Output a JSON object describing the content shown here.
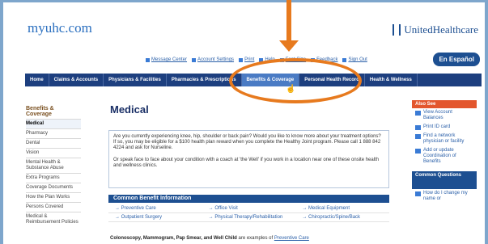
{
  "header": {
    "logo": "myuhc.com",
    "brand": "UnitedHealthcare",
    "espanol": "En Español"
  },
  "util_links": [
    "Message Center",
    "Account Settings",
    "Print",
    "Help",
    "Font Size",
    "Feedback",
    "Sign Out"
  ],
  "nav": [
    {
      "label": "Home"
    },
    {
      "label": "Claims & Accounts"
    },
    {
      "label": "Physicians & Facilities"
    },
    {
      "label": "Pharmacies & Prescriptions"
    },
    {
      "label": "Benefits & Coverage"
    },
    {
      "label": "Personal Health Record"
    },
    {
      "label": "Health & Wellness"
    }
  ],
  "sidebar": {
    "heading": "Benefits & Coverage",
    "items": [
      "Medical",
      "Pharmacy",
      "Dental",
      "Vision",
      "Mental Health & Substance Abuse",
      "Extra Programs",
      "Coverage Documents",
      "How the Plan Works",
      "Persons Covered",
      "Medical & Reimbursement Policies"
    ]
  },
  "main": {
    "title": "Medical",
    "intro_1": "Are you currently experiencing knee, hip, shoulder or back pain? Would you like to know more about your treatment options? If so, you may be eligible for a $100 health plan reward when you complete the Healthy Joint program. Please call 1 888 842 4224 and ask for Nurseline.",
    "intro_2": "Or speak face to face about your condition with a coach at 'the Well' if you work in a location near one of these onsite health and wellness clinics.",
    "common_header": "Common Benefit Information",
    "benefits": [
      "Preventive Care",
      "Office Visit",
      "Medical Equipment",
      "Outpatient Surgery",
      "Physical Therapy/Rehabilitation",
      "Chiropractic/Spine/Back"
    ],
    "colono_bold": "Colonoscopy, Mammogram, Pap Smear, and Well Child",
    "colono_text": "are examples of",
    "colono_link": "Preventive Care"
  },
  "rail": {
    "see_also": "Also See",
    "items": [
      "View Account Balances",
      "Print ID card",
      "Find a network physician or facility",
      "Add or update Coordination of Benefits"
    ],
    "questions": "Common Questions",
    "q_item": "How do I change my name or"
  }
}
